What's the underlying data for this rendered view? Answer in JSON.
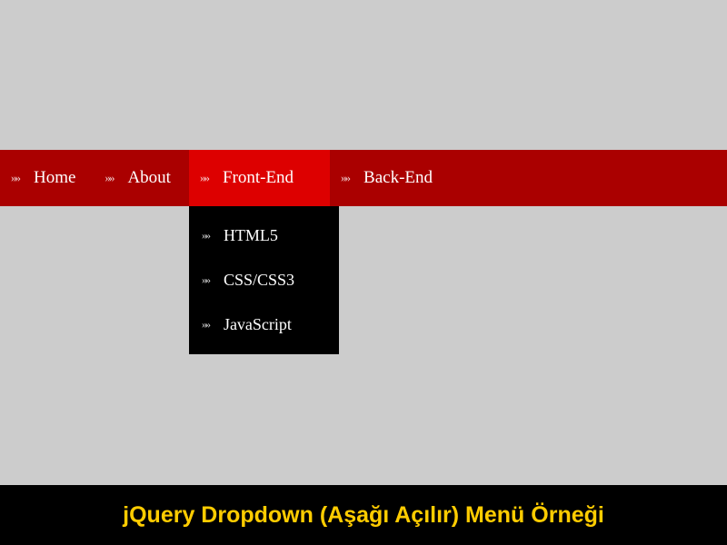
{
  "nav": {
    "items": [
      {
        "label": "Home"
      },
      {
        "label": "About"
      },
      {
        "label": "Front-End"
      },
      {
        "label": "Back-End"
      }
    ],
    "dropdown": {
      "items": [
        {
          "label": "HTML5"
        },
        {
          "label": "CSS/CSS3"
        },
        {
          "label": "JavaScript"
        }
      ]
    }
  },
  "footer": {
    "title": "jQuery Dropdown (Aşağı Açılır) Menü Örneği"
  },
  "icons": {
    "double_arrow": "»»"
  }
}
